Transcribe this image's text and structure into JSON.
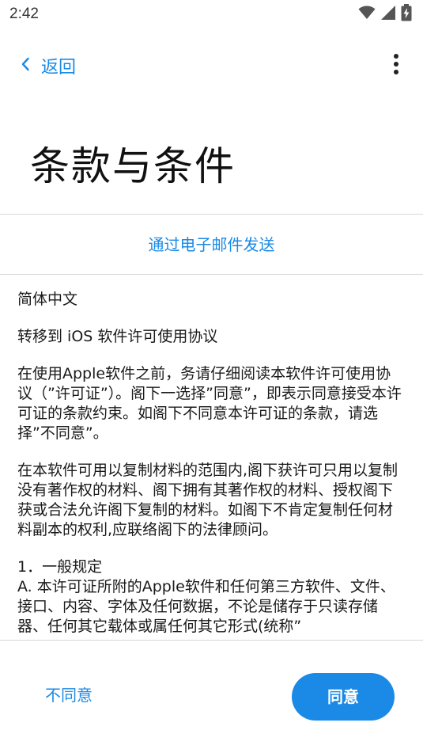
{
  "status_bar": {
    "time": "2:42",
    "icons": [
      "wifi-icon",
      "signal-icon",
      "battery-charging-icon"
    ]
  },
  "nav": {
    "back_label": "返回",
    "back_icon": "chevron-left-icon",
    "more_icon": "more-vertical-icon"
  },
  "header": {
    "title": "条款与条件"
  },
  "email_link": "通过电子邮件发送",
  "content": {
    "language": "简体中文",
    "agreement_title": "转移到 iOS 软件许可使用协议",
    "para1": "在使用Apple软件之前，务请仔细阅读本软件许可使用协议（”许可证”）。阁下一选择”同意”，即表示同意接受本许可证的条款约束。如阁下不同意本许可证的条款，请选择”不同意”。",
    "para2": "在本软件可用以复制材料的范围内,阁下获许可只用以复制没有著作权的材料、阁下拥有其著作权的材料、授权阁下获或合法允许阁下复制的材料。如阁下不肯定复制任何材料副本的权利,应联络阁下的法律顾问。",
    "section1_heading": "1．一般规定",
    "section1_a": "A. 本许可证所附的Apple软件和任何第三方软件、文件、接口、内容、字体及任何数据，不论是储存于只读存储器、任何其它载体或属任何其它形式(统称”"
  },
  "footer": {
    "disagree_label": "不同意",
    "agree_label": "同意"
  },
  "colors": {
    "accent": "#1a8ae6",
    "divider": "#d8d8d8",
    "text": "#1a1a1a"
  }
}
